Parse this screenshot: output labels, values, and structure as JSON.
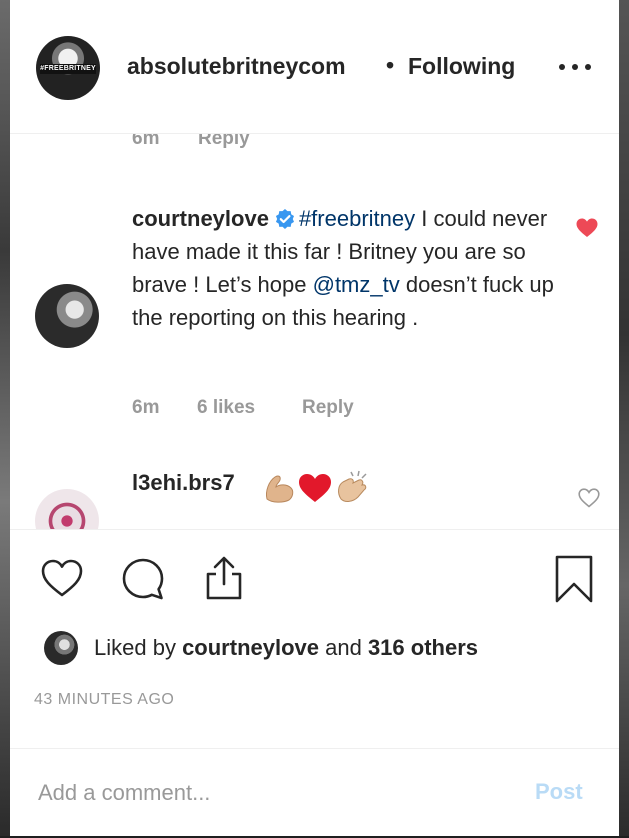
{
  "header": {
    "avatar_badge": "#FREEBRITNEY",
    "username": "absolutebritneycom",
    "separator": "•",
    "follow_status": "Following",
    "more_icon": "more-horizontal-icon"
  },
  "comments": [
    {
      "time": "6m",
      "reply_label": "Reply"
    },
    {
      "username": "courtneylove",
      "verified": true,
      "text_parts": {
        "hashtag": "#freebritney",
        "body_1": " I could never have made it this far ! Britney you are so brave ! Let’s hope ",
        "mention": "@tmz_tv",
        "body_2": " doesn’t fuck up the reporting on this hearing ."
      },
      "time": "6m",
      "likes": "6 likes",
      "reply_label": "Reply",
      "liked": true
    },
    {
      "username": "l3ehi.brs7",
      "emojis": [
        "flexed-biceps",
        "red-heart",
        "clapping-hands"
      ],
      "liked": false
    }
  ],
  "actions": {
    "icons": [
      "heart-outline-icon",
      "comment-bubble-icon",
      "share-upload-icon",
      "bookmark-icon"
    ]
  },
  "likes_summary": {
    "prefix": "Liked by ",
    "user": "courtneylove",
    "and": " and ",
    "others": "316 others"
  },
  "timestamp": "43 MINUTES AGO",
  "comment_box": {
    "placeholder": "Add a comment...",
    "post_label": "Post"
  },
  "colors": {
    "text": "#262626",
    "muted": "#999999",
    "link": "#003569",
    "verified": "#3897f0",
    "like_red": "#ed4956",
    "post_disabled": "#b9dbf6"
  }
}
